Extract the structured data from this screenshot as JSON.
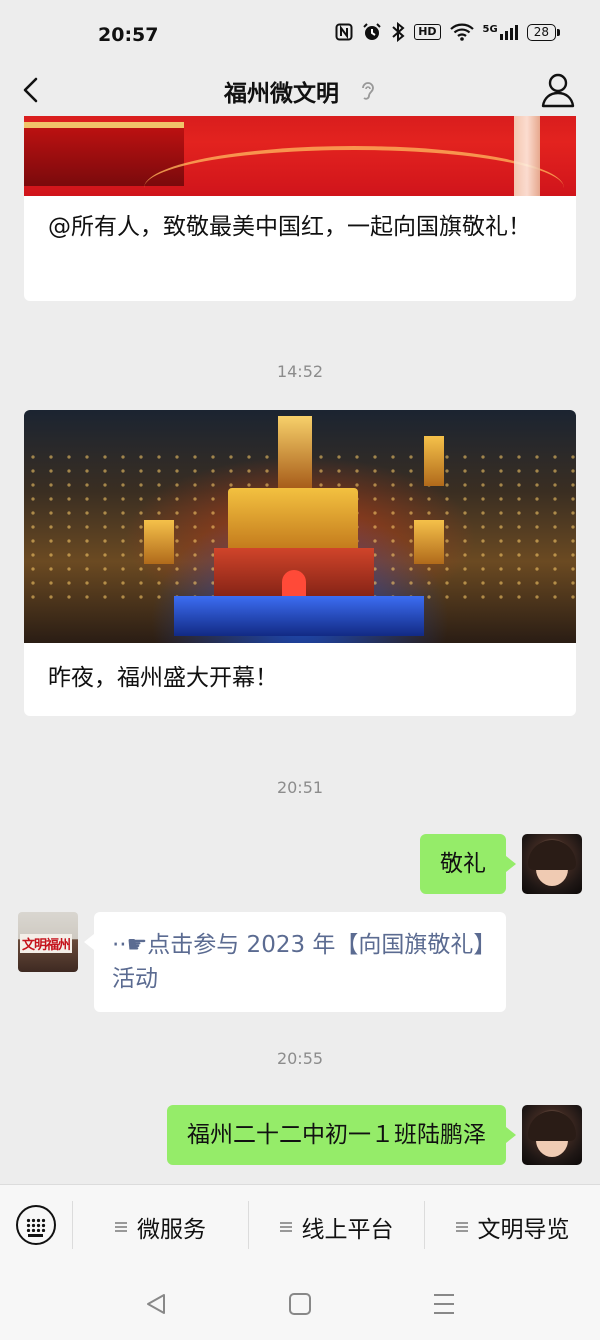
{
  "status_bar": {
    "time": "20:57",
    "icons": [
      "nfc-icon",
      "alarm-icon",
      "bluetooth-icon",
      "hd-icon",
      "wifi-icon",
      "signal-5g-icon"
    ],
    "hd_label": "HD",
    "network_label": "5G",
    "battery": "28"
  },
  "header": {
    "title": "福州微文明",
    "back_icon": "back-chevron-icon",
    "ear_icon": "earpiece-icon",
    "profile_icon": "profile-icon"
  },
  "messages": {
    "card1_text": "@所有人，致敬最美中国红，一起向国旗敬礼！",
    "ts1": "14:52",
    "card2_text": "昨夜，福州盛大开幕！",
    "ts2": "20:51",
    "my_msg1": "敬礼",
    "official_sign": "文明福州",
    "official_reply_prefix": "··☛",
    "official_reply": "点击参与 2023 年【向国旗敬礼】活动",
    "ts3": "20:55",
    "my_msg2": "福州二十二中初一１班陆鹏泽"
  },
  "menu": {
    "items": [
      "微服务",
      "线上平台",
      "文明导览"
    ],
    "keyboard_icon": "keyboard-icon"
  },
  "system_nav": [
    "back-triangle-icon",
    "home-square-icon",
    "recents-menu-icon"
  ],
  "colors": {
    "background": "#ededed",
    "my_bubble": "#95ec69",
    "link_text": "#5b6b91",
    "timestamp": "#8c8c8c"
  }
}
